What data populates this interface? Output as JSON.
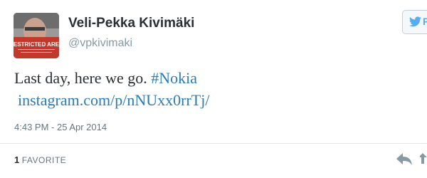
{
  "user": {
    "display_name": "Veli-Pekka Kivimäki",
    "screen_name": "@vpkivimaki",
    "avatar_sign_text": "RESTRICTED AREA"
  },
  "follow_button": {
    "icon": "twitter-bird-icon",
    "label": "F"
  },
  "tweet": {
    "text_plain": "Last day, here we go. ",
    "hashtag": "#Nokia",
    "link": "instagram.com/p/nNUxx0rrTj/",
    "timestamp": "4:43 PM - 25 Apr 2014"
  },
  "stats": {
    "favorite_count": "1",
    "favorite_label": "FAVORITE"
  },
  "actions": {
    "reply_icon": "reply-icon",
    "retweet_icon": "retweet-icon"
  },
  "colors": {
    "link": "#2b7bb9",
    "name": "#292f33",
    "muted": "#8899a6",
    "brand": "#55acee"
  }
}
